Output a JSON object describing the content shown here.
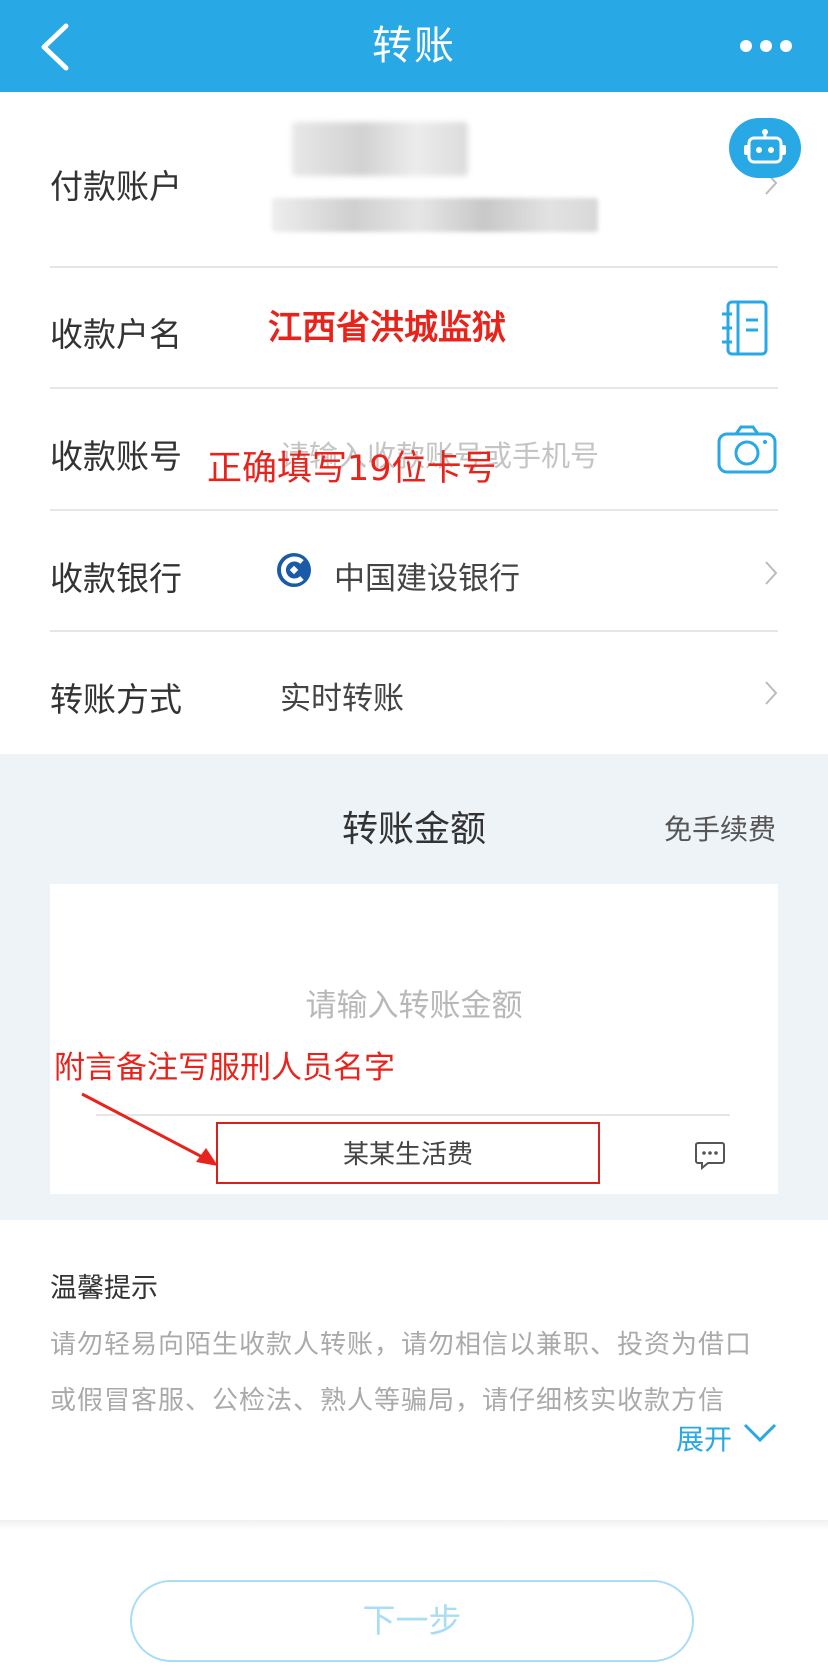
{
  "header": {
    "title": "转账",
    "back_icon": "back-arrow-icon",
    "more_icon": "more-dots-icon",
    "bg_color": "#29a8e6"
  },
  "form": {
    "payer_label": "付款账户",
    "payee_name_label": "收款户名",
    "payee_name_value": "江西省洪城监狱",
    "account_label": "收款账号",
    "account_placeholder": "请输入收款账号或手机号",
    "bank_label": "收款银行",
    "bank_value": "中国建设银行",
    "method_label": "转账方式",
    "method_value": "实时转账"
  },
  "amount": {
    "title": "转账金额",
    "fee": "免手续费",
    "placeholder": "请输入转账金额",
    "note_value": "某某生活费"
  },
  "annotations": {
    "account_hint": "正确填写19位卡号",
    "note_hint": "附言备注写服刑人员名字",
    "color": "#e8231b"
  },
  "tips": {
    "title": "温馨提示",
    "line1": "请勿轻易向陌生收款人转账，请勿相信以兼职、投资为借口",
    "line2": "或假冒客服、公检法、熟人等骗局，请仔细核实收款方信",
    "expand": "展开"
  },
  "footer": {
    "next_label": "下一步"
  }
}
